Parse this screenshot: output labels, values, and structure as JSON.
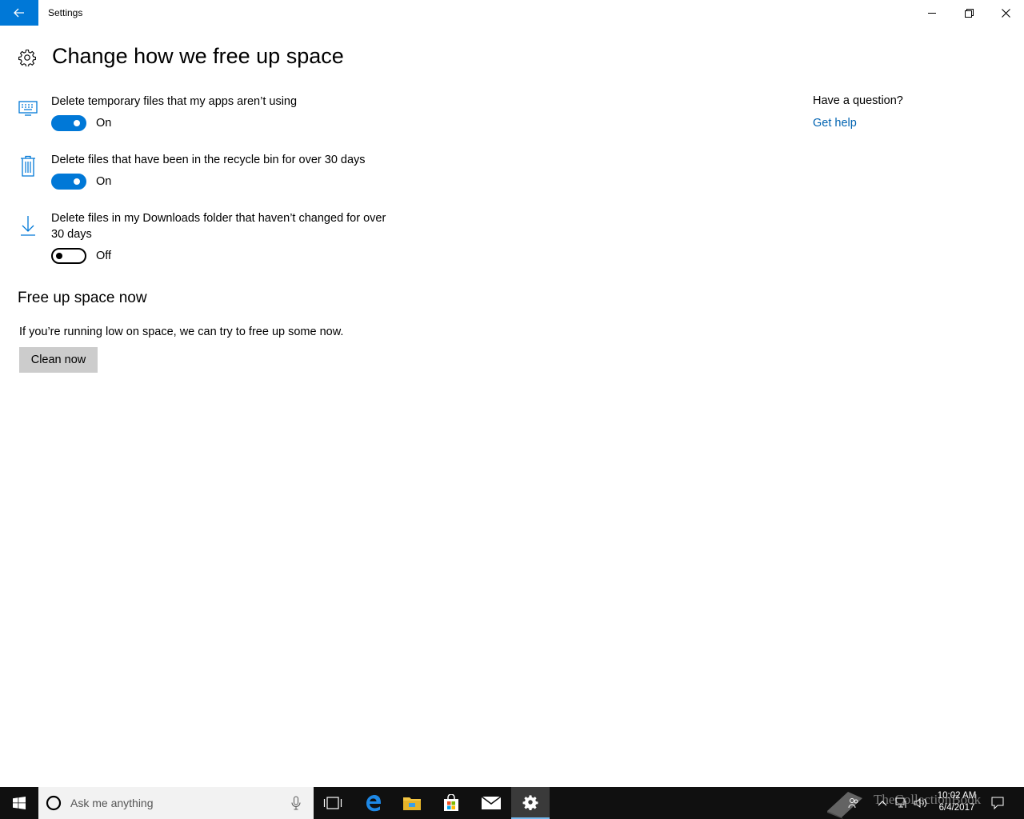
{
  "window": {
    "title": "Settings",
    "controls": {
      "minimize": "minimize-icon",
      "maximize": "restore-icon",
      "close": "close-icon"
    },
    "accent": "#0078d7"
  },
  "page": {
    "title": "Change how we free up space",
    "icon": "gear-icon"
  },
  "settings": [
    {
      "label": "Delete temporary files that my apps aren’t using",
      "state": "On",
      "on": true,
      "icon": "temp-files-icon"
    },
    {
      "label": "Delete files that have been in the recycle bin for over 30 days",
      "state": "On",
      "on": true,
      "icon": "recycle-bin-icon"
    },
    {
      "label": "Delete files in my Downloads folder that haven’t changed for over 30 days",
      "state": "Off",
      "on": false,
      "icon": "download-icon"
    }
  ],
  "free_up": {
    "title": "Free up space now",
    "description": "If you’re running low on space, we can try to free up some now.",
    "button": "Clean now"
  },
  "help": {
    "title": "Have a question?",
    "link": "Get help"
  },
  "taskbar": {
    "search_placeholder": "Ask me anything",
    "time": "10:02 AM",
    "date": "6/4/2017",
    "watermark": "TheCollectionBook"
  }
}
